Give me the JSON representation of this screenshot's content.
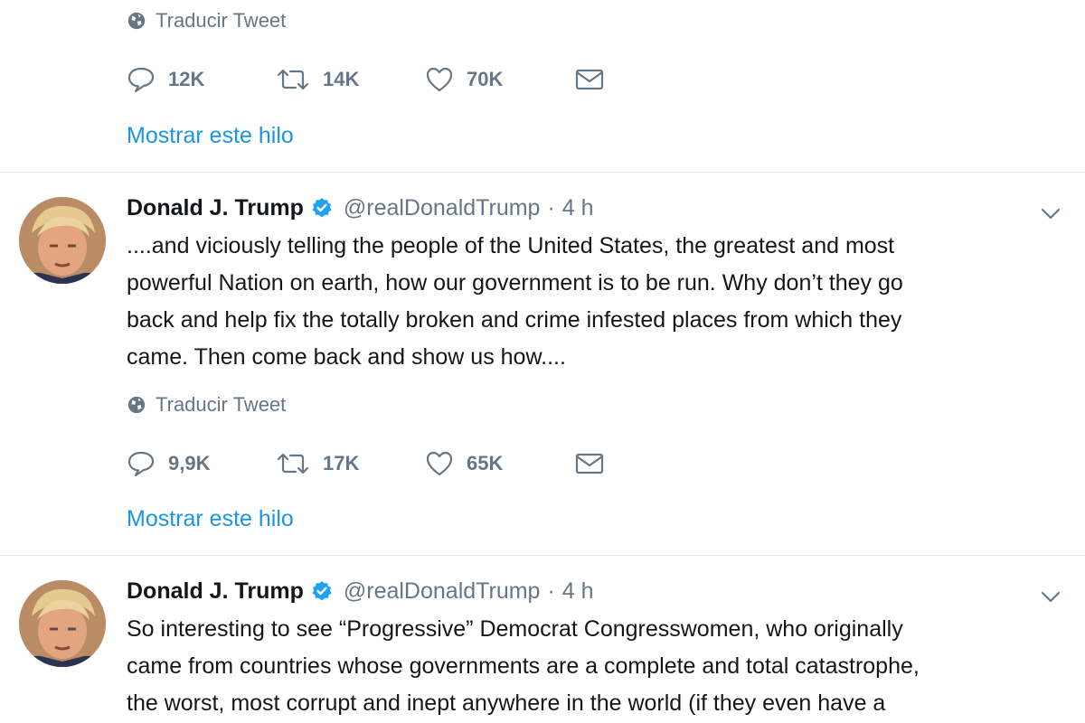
{
  "colors": {
    "text": "#14171a",
    "muted": "#657786",
    "link": "#1b95e0",
    "verified": "#1da1f2",
    "divider": "#e6ecf0"
  },
  "icons": {
    "translate": "globe-icon",
    "reply": "reply-icon",
    "retweet": "retweet-icon",
    "like": "heart-icon",
    "dm": "envelope-icon",
    "verified": "verified-badge-icon",
    "caret": "chevron-down-icon"
  },
  "top": {
    "translate_label": "Traducir Tweet",
    "actions": {
      "replies": "12K",
      "retweets": "14K",
      "likes": "70K"
    },
    "show_thread": "Mostrar este hilo"
  },
  "tweets": [
    {
      "name": "Donald J. Trump",
      "handle": "@realDonaldTrump",
      "separator": "·",
      "time": "4 h",
      "text": "....and viciously telling the people of the United States, the greatest and most\npowerful Nation on earth, how our government is to be run. Why don’t they go\nback and help fix the totally broken and crime infested places from which they\ncame. Then come back and show us how....",
      "translate_label": "Traducir Tweet",
      "actions": {
        "replies": "9,9K",
        "retweets": "17K",
        "likes": "65K"
      },
      "show_thread": "Mostrar este hilo"
    },
    {
      "name": "Donald J. Trump",
      "handle": "@realDonaldTrump",
      "separator": "·",
      "time": "4 h",
      "text": "So interesting to see “Progressive” Democrat Congresswomen, who originally\ncame from countries whose governments are a complete and total catastrophe,\nthe worst, most corrupt and inept anywhere in the world (if they even have a"
    }
  ]
}
